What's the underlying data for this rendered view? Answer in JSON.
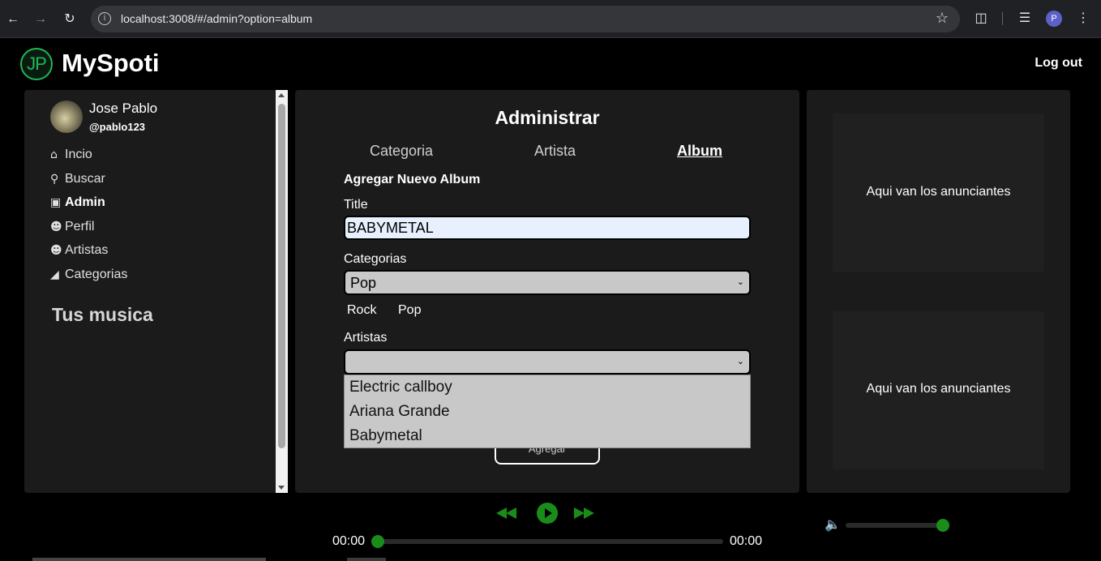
{
  "browser": {
    "url": "localhost:3008/#/admin?option=album",
    "profile_initial": "P"
  },
  "header": {
    "logo_text": "JP",
    "app_title": "MySpoti",
    "logout_label": "Log out"
  },
  "sidebar": {
    "user_name": "Jose Pablo",
    "user_handle": "@pablo123",
    "items": [
      {
        "label": "Incio",
        "icon": "home-icon"
      },
      {
        "label": "Buscar",
        "icon": "search-icon"
      },
      {
        "label": "Admin",
        "icon": "briefcase-icon",
        "active": true
      },
      {
        "label": "Perfil",
        "icon": "user-icon"
      },
      {
        "label": "Artistas",
        "icon": "users-icon"
      },
      {
        "label": "Categorias",
        "icon": "tag-icon"
      }
    ],
    "music_heading": "Tus musica"
  },
  "main": {
    "title": "Administrar",
    "tabs": [
      {
        "label": "Categoria",
        "active": false
      },
      {
        "label": "Artista",
        "active": false
      },
      {
        "label": "Album",
        "active": true
      }
    ],
    "form": {
      "heading": "Agregar Nuevo Album",
      "title_label": "Title",
      "title_value": "BABYMETAL",
      "categorias_label": "Categorias",
      "categorias_selected": "Pop",
      "selected_categories": [
        "Rock",
        "Pop"
      ],
      "artistas_label": "Artistas",
      "artistas_selected": "",
      "artistas_options": [
        "Electric callboy",
        "Ariana Grande",
        "Babymetal"
      ],
      "submit_label": "Agregar"
    }
  },
  "ads": {
    "text_1": "Aqui van los anunciantes",
    "text_2": "Aqui van los anunciantes"
  },
  "player": {
    "current_time": "00:00",
    "total_time": "00:00",
    "progress": 0,
    "volume": 1.0,
    "accent_color": "#1a8c1a"
  }
}
